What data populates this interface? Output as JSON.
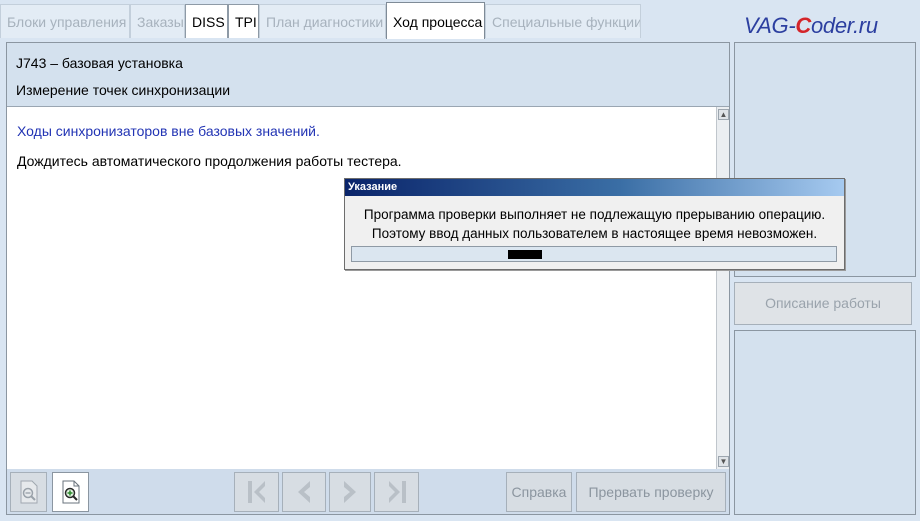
{
  "tabs": [
    {
      "label": "Блоки управления",
      "state": "disabled"
    },
    {
      "label": "Заказы",
      "state": "disabled"
    },
    {
      "label": "DISS",
      "state": "enabled"
    },
    {
      "label": "TPI",
      "state": "enabled"
    },
    {
      "label": "План диагностики",
      "state": "disabled"
    },
    {
      "label": "Ход процесса",
      "state": "active"
    },
    {
      "label": "Специальные функции",
      "state": "disabled"
    }
  ],
  "watermark": {
    "part1": "VAG-",
    "part2": "C",
    "part3": "oder.ru"
  },
  "header": {
    "unit": "J743 – базовая установка",
    "step": "Измерение точек синхронизации"
  },
  "content": {
    "status_message": "Ходы синхронизаторов вне базовых значений.",
    "instruction": "Дождитесь автоматического продолжения работы тестера."
  },
  "toolbar": {
    "help_label": "Справка",
    "abort_label": "Прервать проверку"
  },
  "right_panel": {
    "work_description_label": "Описание работы"
  },
  "dialog": {
    "title": "Указание",
    "line1": "Программа проверки выполняет не подлежащую прерыванию операцию.",
    "line2": "Поэтому ввод данных пользователем в настоящее время невозможен."
  },
  "colors": {
    "background": "#d9e5f2",
    "status_message": "#2234b4",
    "title_bar_start": "#0a246a",
    "title_bar_end": "#a6caf0"
  }
}
